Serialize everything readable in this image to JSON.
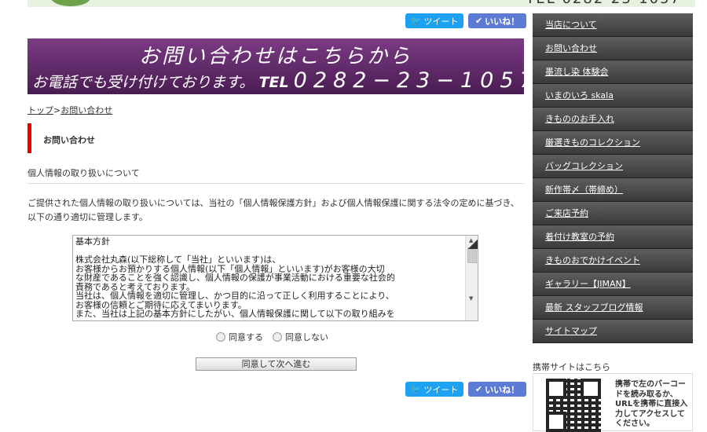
{
  "header": {
    "tel_partial": "TEL 0282-23-1057"
  },
  "social": {
    "tweet": "ツイート",
    "like": "いいね！"
  },
  "banner": {
    "line1": "お問い合わせはこちらから",
    "line2": "お電話でも受け付けております。",
    "tel": "TEL",
    "number": "0282−23−1057"
  },
  "breadcrumb": {
    "home": "トップ",
    "sep": ">",
    "current": "お問い合わせ"
  },
  "page": {
    "heading": "お問い合わせ",
    "subheading": "個人情報の取り扱いについて",
    "intro": "ご提供された個人情報の取り扱いについては、当社の「個人情報保護方針」および個人情報保護に関する法令の定めに基づき、以下の通り適切に管理します。"
  },
  "policy": {
    "text": "基本方針\n\n株式会社丸森(以下総称して「当社」といいます)は、\nお客様からお預かりする個人情報(以下「個人情報」といいます)がお客様の大切\nな財産であることを強く認識し、個人情報の保護が事業活動における重要な社会的\n責務であると考えております。\n当社は、個人情報を適切に管理し、かつ目的に沿って正しく利用することにより、\nお客様の信頼とご期待に応えてまいります。\nまた、当社は上記の基本方針にしたがい、個人情報保護に関して以下の取り組みを"
  },
  "consent": {
    "agree": "同意する",
    "disagree": "同意しない",
    "submit": "同意して次へ進む"
  },
  "sidebar": {
    "items": [
      "当店について",
      "お問い合わせ",
      "墨流し染 体験会",
      "いまのいろ skala",
      "きもののお手入れ",
      "厳選きものコレクション",
      "バッグコレクション",
      "新作帯〆（帯締め）",
      "ご来店予約",
      "着付け教室の予約",
      "きものおでかけイベント",
      "ギャラリー【JIMAN】",
      "最新 スタッフブログ情報",
      "サイトマップ"
    ]
  },
  "mobile": {
    "label": "携帯サイトはこちら",
    "text": "携帯で左のバーコードを読み取るか、URLを携帯に直接入力してアクセスしてください。"
  }
}
